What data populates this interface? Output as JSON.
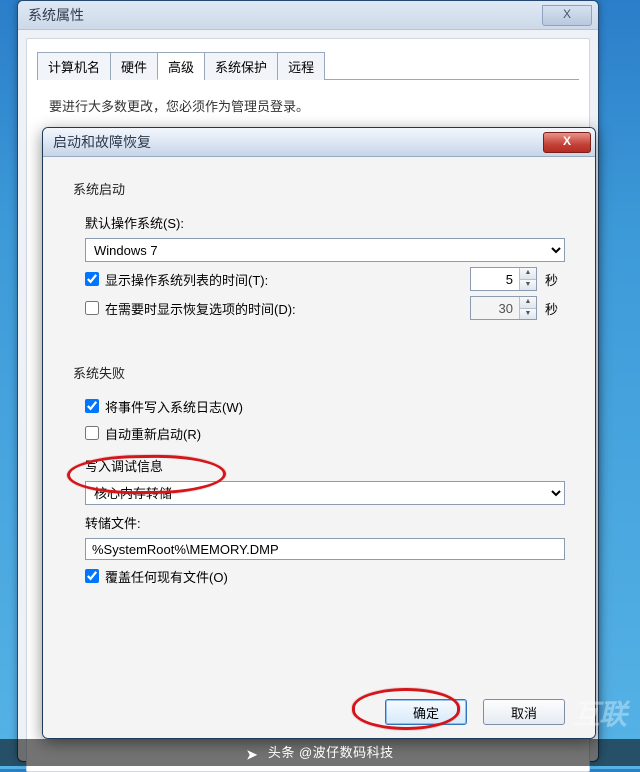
{
  "parent": {
    "title": "系统属性",
    "tabs": [
      "计算机名",
      "硬件",
      "高级",
      "系统保护",
      "远程"
    ],
    "active_tab": 2,
    "body_text": "要进行大多数更改，您必须作为管理员登录。"
  },
  "dialog": {
    "title": "启动和故障恢复",
    "sections": {
      "startup": {
        "title": "系统启动",
        "default_os_label": "默认操作系统(S):",
        "default_os_value": "Windows 7",
        "show_list": {
          "checked": true,
          "label": "显示操作系统列表的时间(T):",
          "value": "5",
          "unit": "秒"
        },
        "show_recovery": {
          "checked": false,
          "label": "在需要时显示恢复选项的时间(D):",
          "value": "30",
          "unit": "秒"
        }
      },
      "failure": {
        "title": "系统失败",
        "log_event": {
          "checked": true,
          "label": "将事件写入系统日志(W)"
        },
        "auto_restart": {
          "checked": false,
          "label": "自动重新启动(R)"
        },
        "write_debug_label": "写入调试信息",
        "write_debug_value": "核心内存转储",
        "dump_label": "转储文件:",
        "dump_value": "%SystemRoot%\\MEMORY.DMP",
        "overwrite": {
          "checked": true,
          "label": "覆盖任何现有文件(O)"
        }
      }
    },
    "buttons": {
      "ok": "确定",
      "cancel": "取消"
    }
  },
  "footer": {
    "prefix": "头条",
    "source": "@波仔数码科技"
  },
  "watermark": "互联"
}
